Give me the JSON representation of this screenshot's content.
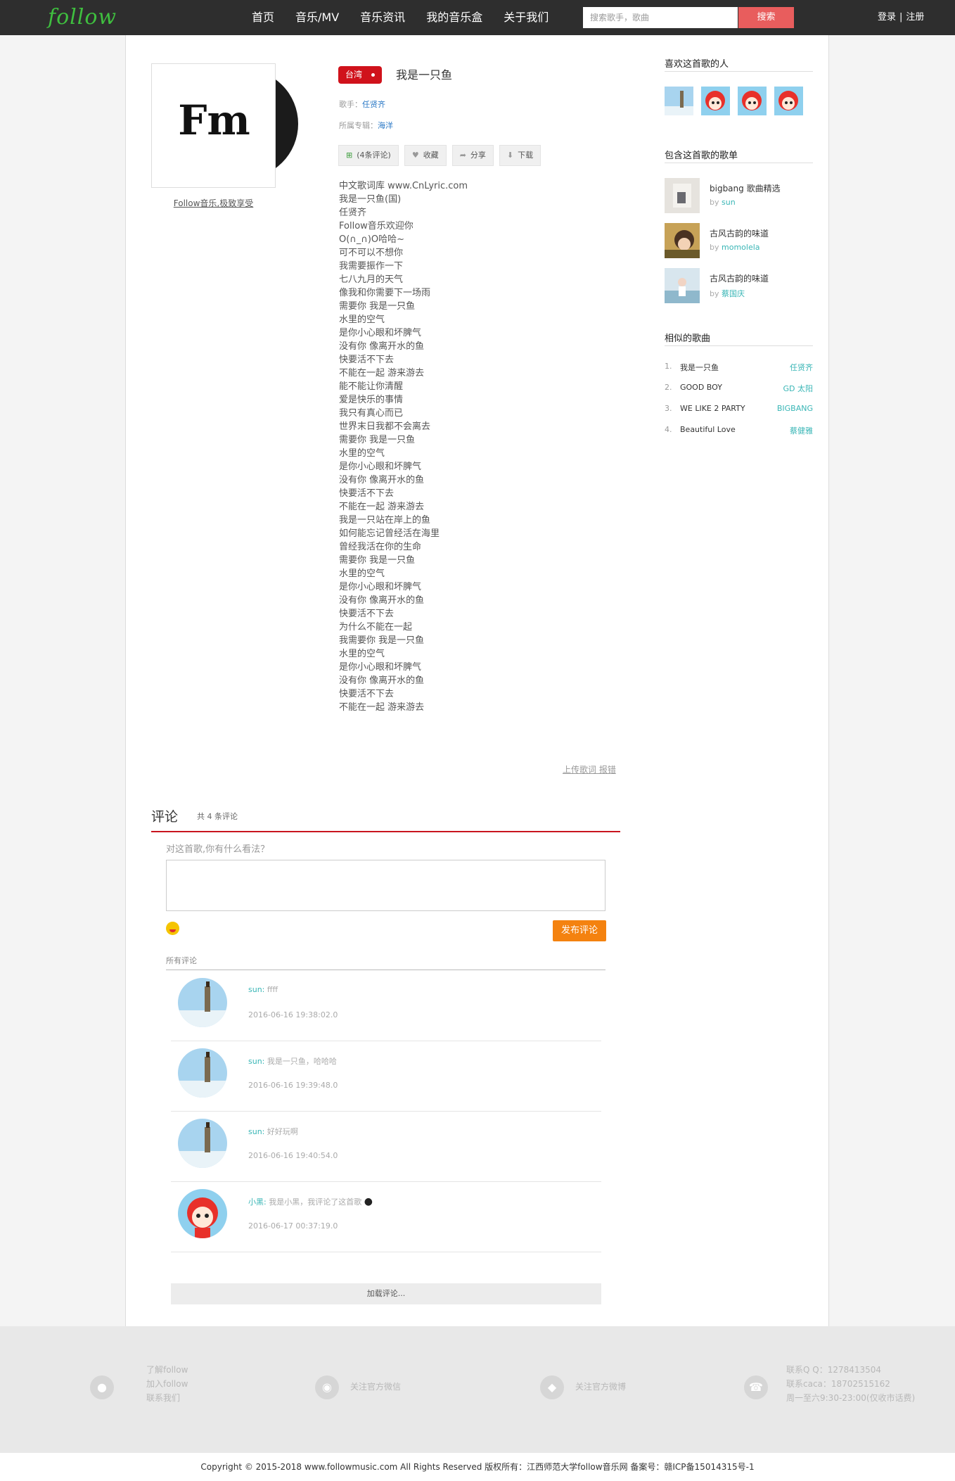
{
  "header": {
    "logo": "follow",
    "nav": [
      "首页",
      "音乐/MV",
      "音乐资讯",
      "我的音乐盒",
      "关于我们"
    ],
    "search_placeholder": "搜索歌手，歌曲",
    "search_button": "搜索",
    "login": "登录",
    "separator": "|",
    "register": "注册"
  },
  "song": {
    "cover_text": "Fm",
    "cover_caption": "Follow音乐,极致享受",
    "region": "台湾",
    "title": "我是一只鱼",
    "singer_label": "歌手：",
    "singer": "任贤齐",
    "album_label": "所属专辑：",
    "album": "海洋",
    "buttons": {
      "comment": "(4条评论)",
      "collect": "收藏",
      "share": "分享",
      "download": "下载"
    },
    "lyrics": [
      "中文歌词库 www.CnLyric.com",
      "我是一只鱼(国)",
      "任贤齐",
      "Follow音乐欢迎你",
      "O(∩_∩)O哈哈~",
      "可不可以不想你",
      "我需要振作一下",
      "七八九月的天气",
      "像我和你需要下一场雨",
      "需要你 我是一只鱼",
      "水里的空气",
      "是你小心眼和坏脾气",
      "没有你 像离开水的鱼",
      "快要活不下去",
      "不能在一起 游来游去",
      "能不能让你清醒",
      "爱是快乐的事情",
      "我只有真心而已",
      "世界末日我都不会离去",
      "需要你 我是一只鱼",
      "水里的空气",
      "是你小心眼和坏脾气",
      "没有你 像离开水的鱼",
      "快要活不下去",
      "不能在一起 游来游去",
      "我是一只站在岸上的鱼",
      "如何能忘记曾经活在海里",
      "曾经我活在你的生命",
      "需要你 我是一只鱼",
      "水里的空气",
      "是你小心眼和坏脾气",
      "没有你 像离开水的鱼",
      "快要活不下去",
      "为什么不能在一起",
      "我需要你 我是一只鱼",
      "水里的空气",
      "是你小心眼和坏脾气",
      "没有你 像离开水的鱼",
      "快要活不下去",
      "不能在一起 游来游去"
    ],
    "upload_link": "上传歌词 报错"
  },
  "comments": {
    "title": "评论",
    "count_text": "共 4 条评论",
    "prompt": "对这首歌,你有什么看法？",
    "post_button": "发布评论",
    "all_label": "所有评论",
    "items": [
      {
        "user": "sun:",
        "text": "ffff",
        "time": "2016-06-16 19:38:02.0"
      },
      {
        "user": "sun:",
        "text": "我是一只鱼，哈哈哈",
        "time": "2016-06-16 19:39:48.0"
      },
      {
        "user": "sun:",
        "text": "好好玩啊",
        "time": "2016-06-16 19:40:54.0"
      },
      {
        "user": "小黑:",
        "text": "我是小黑，我评论了这首歌",
        "time": "2016-06-17 00:37:19.0"
      }
    ],
    "load_more": "加载评论..."
  },
  "sidebar": {
    "likes_title": "喜欢这首歌的人",
    "playlists_title": "包含这首歌的歌单",
    "playlists": [
      {
        "name": "bigbang 歌曲精选",
        "by": "by",
        "user": "sun"
      },
      {
        "name": "古风古韵的味道",
        "by": "by",
        "user": "momolela"
      },
      {
        "name": "古风古韵的味道",
        "by": "by",
        "user": "蔡国庆"
      }
    ],
    "similar_title": "相似的歌曲",
    "similar": [
      {
        "no": "1.",
        "name": "我是一只鱼",
        "artist": "任贤齐"
      },
      {
        "no": "2.",
        "name": "GOOD BOY",
        "artist": "GD 太阳"
      },
      {
        "no": "3.",
        "name": "WE LIKE 2 PARTY",
        "artist": "BIGBANG"
      },
      {
        "no": "4.",
        "name": "Beautiful Love",
        "artist": "蔡健雅"
      }
    ]
  },
  "footer": {
    "about": [
      "了解follow",
      "加入follow",
      "联系我们"
    ],
    "wechat": "关注官方微信",
    "weibo": "关注官方微博",
    "contact": [
      "联系Q Q：1278413504",
      "联系caca：18702515162",
      "周一至六9:30-23:00(仅收市话费)"
    ],
    "copyright": "Copyright © 2015-2018 www.followmusic.com All Rights Reserved 版权所有：江西师范大学follow音乐网 备案号：赣ICP备15014315号-1"
  },
  "colors": {
    "topbar": "#2e2e2e",
    "accent_red": "#d0121b",
    "teal": "#39b6b6",
    "orange": "#f4820f",
    "search_red": "#e85d5d"
  }
}
